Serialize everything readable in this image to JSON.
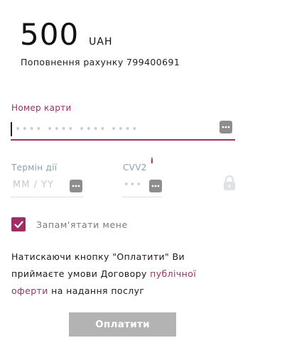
{
  "payment": {
    "amount": "500",
    "currency": "UAH",
    "description": "Поповнення рахунку 799400691"
  },
  "card_number": {
    "label": "Номер карти",
    "placeholder": "•••• •••• •••• ••••"
  },
  "expiry": {
    "label": "Термін дії",
    "placeholder": "MM / YY"
  },
  "cvv": {
    "label": "CVV2",
    "info_mark": "i",
    "placeholder": "•••"
  },
  "remember": {
    "label": "Запам'ятати мене",
    "checked": true
  },
  "terms": {
    "text_before": "Натискаючи кнопку \"Оплатити\" Ви приймаєте умови Договору ",
    "link_text": "публічної оферти",
    "text_after": " на надання послуг"
  },
  "pay_button": {
    "label": "Оплатити"
  },
  "colors": {
    "accent": "#9c2f63",
    "button_disabled": "#b3b3b3",
    "icon_gray": "#8d8d8d"
  },
  "icons": [
    "keyboard-icon",
    "lock-icon",
    "checkmark-icon"
  ]
}
